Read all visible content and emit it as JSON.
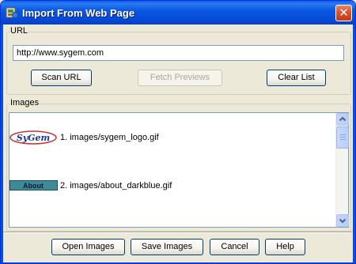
{
  "window": {
    "title": "Import From Web Page",
    "close_glyph": "✕",
    "icon": "app-icon"
  },
  "url_group": {
    "label": "URL",
    "url_value": "http://www.sygem.com"
  },
  "buttons": {
    "scan_url": "Scan URL",
    "fetch_previews": "Fetch Previews",
    "clear_list": "Clear List"
  },
  "images_group": {
    "label": "Images",
    "items": [
      {
        "thumb_text": "SyGem",
        "label": "1. images/sygem_logo.gif"
      },
      {
        "thumb_text": "About",
        "label": "2. images/about_darkblue.gif"
      }
    ]
  },
  "footer": {
    "open_images": "Open Images",
    "save_images": "Save Images",
    "cancel": "Cancel",
    "help": "Help"
  },
  "colors": {
    "title_bar": "#0449d8",
    "close_button": "#d9532c",
    "about_thumb": "#3d8a9a",
    "sygem_thumb_text": "#1a3a9a"
  }
}
